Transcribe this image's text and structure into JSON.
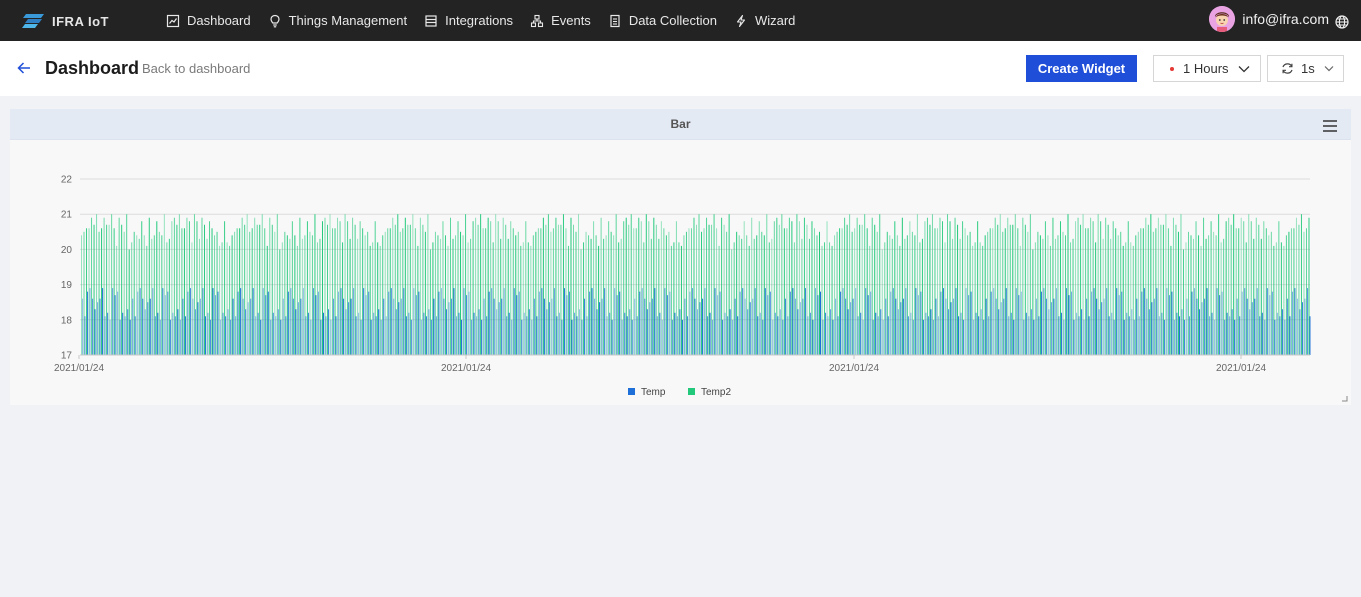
{
  "app": {
    "name": "IFRA IoT"
  },
  "nav": {
    "items": [
      {
        "label": "Dashboard",
        "icon": "chart-icon"
      },
      {
        "label": "Things Management",
        "icon": "bulb-icon"
      },
      {
        "label": "Integrations",
        "icon": "storage-icon"
      },
      {
        "label": "Events",
        "icon": "cluster-icon"
      },
      {
        "label": "Data Collection",
        "icon": "document-icon"
      },
      {
        "label": "Wizard",
        "icon": "thunderbolt-icon"
      }
    ]
  },
  "user": {
    "email": "info@ifra.com"
  },
  "page": {
    "title": "Dashboard",
    "back_label": "Back to dashboard",
    "create_label": "Create Widget",
    "time_range": "1 Hours",
    "refresh_interval": "1s"
  },
  "colors": {
    "primary": "#1f4ed8",
    "temp": "#1f6fd9",
    "temp2": "#22c97b",
    "topbar": "#232323"
  },
  "widget": {
    "title": "Bar"
  },
  "chart_data": {
    "type": "bar",
    "title": "Bar",
    "ylim": [
      17,
      22
    ],
    "yticks": [
      17,
      18,
      19,
      20,
      21,
      22
    ],
    "xticks": [
      "2021/01/24",
      "2021/01/24",
      "2021/01/24",
      "2021/01/24"
    ],
    "grid": true,
    "legend": "bottom-center",
    "series": [
      {
        "name": "Temp",
        "color": "#1f6fd9",
        "values": [
          18.6,
          18.3,
          18.4,
          18.1,
          18.7,
          18.2,
          18.8,
          17.9,
          18.5,
          18.9,
          18.0,
          18.4,
          18.6,
          18.2,
          18.9,
          18.3,
          18.1,
          18.7,
          18.5,
          18.8,
          18.2,
          18.6,
          18.0,
          18.4,
          18.9,
          18.3,
          18.5,
          18.1,
          18.7,
          18.6,
          18.2,
          18.8,
          18.4,
          18.0,
          18.6,
          18.3,
          18.9,
          18.5,
          18.1,
          18.7,
          18.2,
          18.4,
          18.8,
          18.6,
          18.3,
          18.0,
          18.5,
          18.9,
          18.2,
          18.7,
          18.4,
          18.1,
          18.6,
          18.8,
          18.3,
          18.5,
          18.9,
          18.0,
          18.7,
          18.2
        ]
      },
      {
        "name": "Temp2",
        "color": "#22c97b",
        "values": [
          20.4,
          20.8,
          20.1,
          20.9,
          20.6,
          20.3,
          21.0,
          20.5,
          20.2,
          20.9,
          20.7,
          20.4,
          20.8,
          20.0,
          20.6,
          21.0,
          20.3,
          20.7,
          20.5,
          20.9,
          20.2,
          20.6,
          20.8,
          20.4,
          21.0,
          20.1,
          20.7,
          20.5,
          20.9,
          20.3,
          20.8,
          20.6,
          20.2,
          21.0,
          20.4,
          20.7,
          20.9,
          20.5,
          20.1,
          20.8,
          20.6,
          20.3,
          21.0,
          20.7,
          20.4,
          20.9,
          20.2,
          20.6,
          20.8,
          20.5,
          20.3,
          21.0,
          20.7,
          20.1,
          20.9,
          20.4,
          20.6,
          20.8,
          20.2,
          20.5
        ]
      }
    ]
  }
}
